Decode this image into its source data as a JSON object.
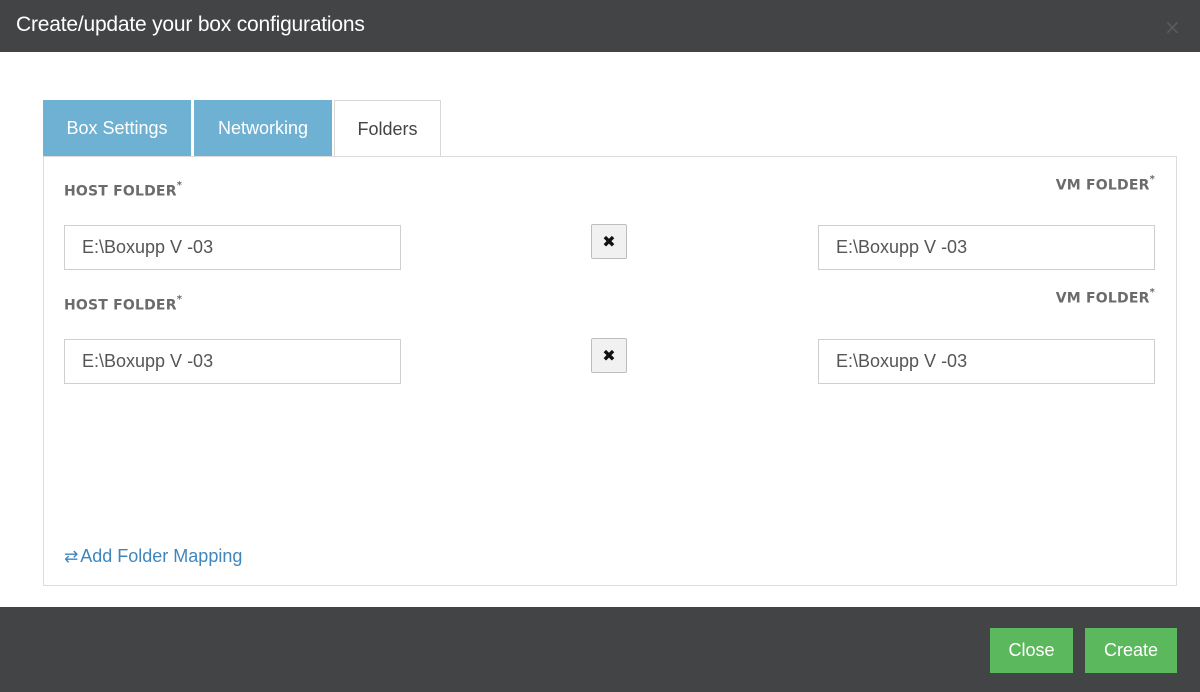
{
  "dialog": {
    "title": "Create/update your box configurations",
    "close_icon": "×"
  },
  "tabs": [
    {
      "label": "Box Settings",
      "active": false
    },
    {
      "label": "Networking",
      "active": false
    },
    {
      "label": "Folders",
      "active": true
    }
  ],
  "mappings": [
    {
      "host_label": "HOST FOLDER",
      "vm_label": "VM FOLDER",
      "required_mark": "*",
      "host_value": "E:\\Boxupp V -03",
      "vm_value": "E:\\Boxupp V -03",
      "remove_icon": "✖"
    },
    {
      "host_label": "HOST FOLDER",
      "vm_label": "VM FOLDER",
      "required_mark": "*",
      "host_value": "E:\\Boxupp V -03",
      "vm_value": "E:\\Boxupp V -03",
      "remove_icon": "✖"
    }
  ],
  "add_mapping": {
    "icon": "⇄",
    "label": "Add Folder Mapping"
  },
  "footer": {
    "close_label": "Close",
    "create_label": "Create"
  },
  "colors": {
    "header_bg": "#434446",
    "tab_inactive": "#6fb1d3",
    "link": "#3e86bd",
    "button_green": "#5cb85c"
  }
}
